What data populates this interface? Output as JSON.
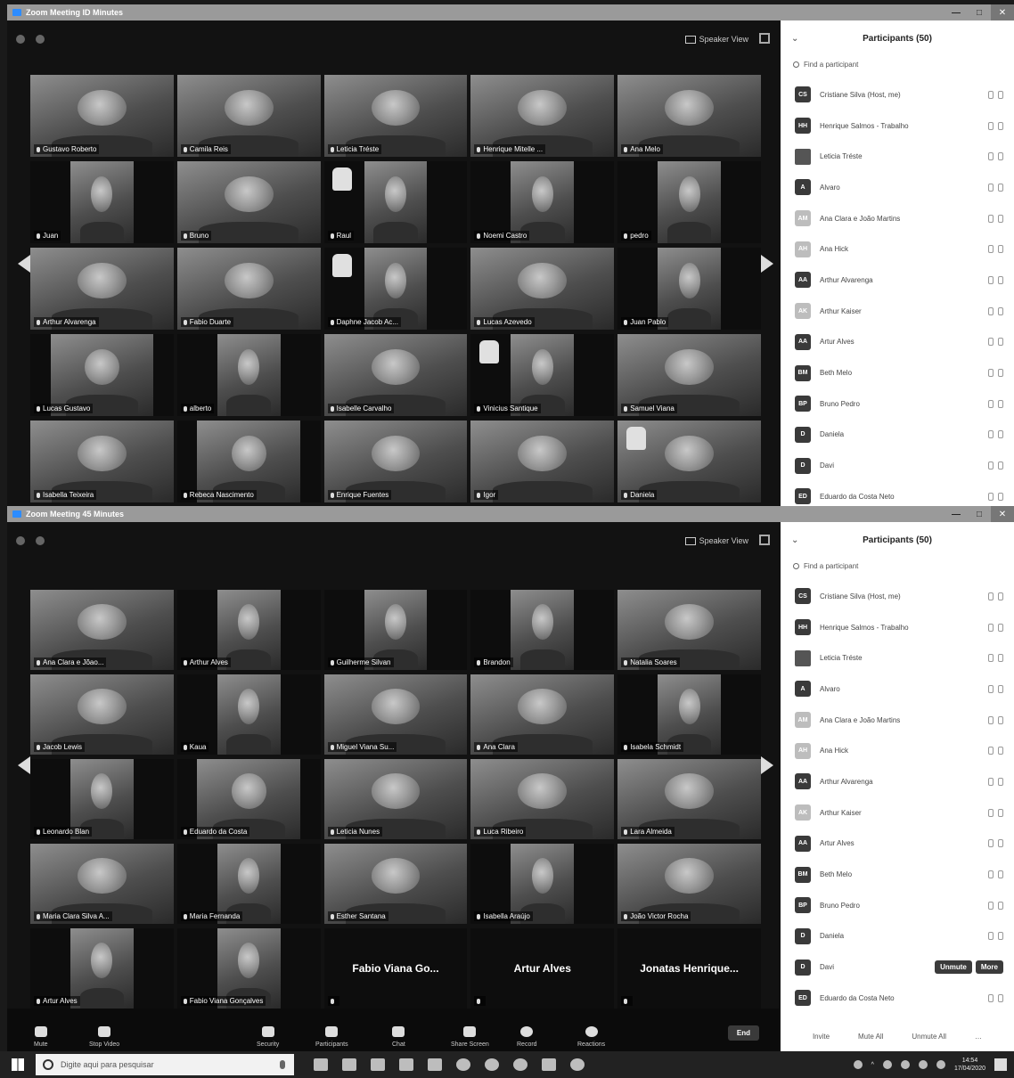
{
  "top_window": {
    "title": "Zoom Meeting ID Minutes",
    "speaker_view_label": "Speaker View",
    "grid": [
      {
        "name": "Gustavo Roberto",
        "layout": "wide"
      },
      {
        "name": "Camila Reis",
        "layout": "wide"
      },
      {
        "name": "Leticia Tréste",
        "layout": "wide",
        "active": true
      },
      {
        "name": "Henrique Mitelle ...",
        "layout": "wide"
      },
      {
        "name": "Ana Melo",
        "layout": "wide"
      },
      {
        "name": "Juan",
        "layout": "narrow"
      },
      {
        "name": "Bruno",
        "layout": "wide"
      },
      {
        "name": "Raul",
        "layout": "narrow",
        "thumb": true
      },
      {
        "name": "Noemi Castro",
        "layout": "narrow"
      },
      {
        "name": "pedro",
        "layout": "narrow"
      },
      {
        "name": "Arthur Alvarenga",
        "layout": "wide"
      },
      {
        "name": "Fabio Duarte",
        "layout": "wide"
      },
      {
        "name": "Daphne Jacob Ac...",
        "layout": "narrow",
        "thumb": true
      },
      {
        "name": "Lucas Azevedo",
        "layout": "wide"
      },
      {
        "name": "Juan Pablo",
        "layout": "narrow"
      },
      {
        "name": "Lucas Gustavo",
        "layout": "mid"
      },
      {
        "name": "alberto",
        "layout": "narrow"
      },
      {
        "name": "Isabelle Carvalho",
        "layout": "wide"
      },
      {
        "name": "Vinicius Santique",
        "layout": "narrow",
        "thumb": true
      },
      {
        "name": "Samuel Viana",
        "layout": "wide"
      },
      {
        "name": "Isabella Teixeira",
        "layout": "wide"
      },
      {
        "name": "Rebeca Nascimento",
        "layout": "mid"
      },
      {
        "name": "Enrique Fuentes",
        "layout": "wide"
      },
      {
        "name": "Igor",
        "layout": "wide"
      },
      {
        "name": "Daniela",
        "layout": "wide",
        "thumb": true
      }
    ]
  },
  "bottom_window": {
    "title": "Zoom Meeting 45 Minutes",
    "speaker_view_label": "Speaker View",
    "grid": [
      {
        "name": "Ana Clara e Jõao...",
        "layout": "wide"
      },
      {
        "name": "Arthur Alves",
        "layout": "narrow"
      },
      {
        "name": "Guilherme Silvan",
        "layout": "narrow"
      },
      {
        "name": "Brandon",
        "layout": "narrow"
      },
      {
        "name": "Natalia Soares",
        "layout": "wide"
      },
      {
        "name": "Jacob Lewis",
        "layout": "wide"
      },
      {
        "name": "Kaua",
        "layout": "narrow"
      },
      {
        "name": "Miguel Viana Su...",
        "layout": "wide"
      },
      {
        "name": "Ana Clara",
        "layout": "wide"
      },
      {
        "name": "Isabela Schmidt",
        "layout": "narrow"
      },
      {
        "name": "Leonardo Blan",
        "layout": "narrow"
      },
      {
        "name": "Eduardo da Costa",
        "layout": "mid"
      },
      {
        "name": "Leticia Nunes",
        "layout": "wide"
      },
      {
        "name": "Luca Ribeiro",
        "layout": "wide"
      },
      {
        "name": "Lara Almeida",
        "layout": "wide"
      },
      {
        "name": "Maria Clara Silva A...",
        "layout": "wide"
      },
      {
        "name": "Maria Fernanda",
        "layout": "narrow"
      },
      {
        "name": "Esther Santana",
        "layout": "wide"
      },
      {
        "name": "Isabella Araújo",
        "layout": "narrow"
      },
      {
        "name": "João Victor Rocha",
        "layout": "wide"
      },
      {
        "name": "Artur Alves",
        "layout": "narrow"
      },
      {
        "name": "Fabio Viana Gonçalves",
        "layout": "narrow"
      },
      {
        "name": "",
        "layout": "empty",
        "big": "Fabio Viana Go..."
      },
      {
        "name": "",
        "layout": "empty",
        "big": "Artur Alves"
      },
      {
        "name": "",
        "layout": "empty",
        "big": "Jonatas Henrique..."
      }
    ],
    "toolbar": [
      {
        "label": "Mute",
        "icon": "mic-icon"
      },
      {
        "label": "Stop Video",
        "icon": "video-camera-icon"
      },
      {
        "label": "Security",
        "icon": "shield-icon"
      },
      {
        "label": "Participants",
        "icon": "participants-icon"
      },
      {
        "label": "Chat",
        "icon": "chat-icon"
      },
      {
        "label": "Share Screen",
        "icon": "share-screen-icon"
      },
      {
        "label": "Record",
        "icon": "record-icon"
      },
      {
        "label": "Reactions",
        "icon": "smiley-icon"
      }
    ],
    "end_label": "End"
  },
  "participants_panel": {
    "title": "Participants (50)",
    "find_placeholder": "Find a participant",
    "rows": [
      {
        "avatar": "CS",
        "name": "Cristiane Silva (Host, me)"
      },
      {
        "avatar": "HH",
        "name": "Henrique Salmos - Trabalho"
      },
      {
        "avatar": "",
        "name": "Leticia Tréste",
        "photo": true
      },
      {
        "avatar": "A",
        "name": "Alvaro"
      },
      {
        "avatar": "AM",
        "name": "Ana Clara e João Martins",
        "light": true
      },
      {
        "avatar": "AH",
        "name": "Ana Hick",
        "light": true
      },
      {
        "avatar": "AA",
        "name": "Arthur Alvarenga"
      },
      {
        "avatar": "AK",
        "name": "Arthur Kaiser",
        "light": true
      },
      {
        "avatar": "AA",
        "name": "Artur Alves"
      },
      {
        "avatar": "BM",
        "name": "Beth Melo"
      },
      {
        "avatar": "BP",
        "name": "Bruno Pedro"
      },
      {
        "avatar": "D",
        "name": "Daniela"
      },
      {
        "avatar": "D",
        "name": "Davi"
      },
      {
        "avatar": "ED",
        "name": "Eduardo da Costa Neto"
      }
    ],
    "unmute_label": "Unmute",
    "more_label": "More",
    "footer": [
      "Invite",
      "Mute All",
      "Unmute All"
    ]
  },
  "taskbar": {
    "search_placeholder": "Digite aqui para pesquisar",
    "time": "14:54",
    "date": "17/04/2020"
  }
}
